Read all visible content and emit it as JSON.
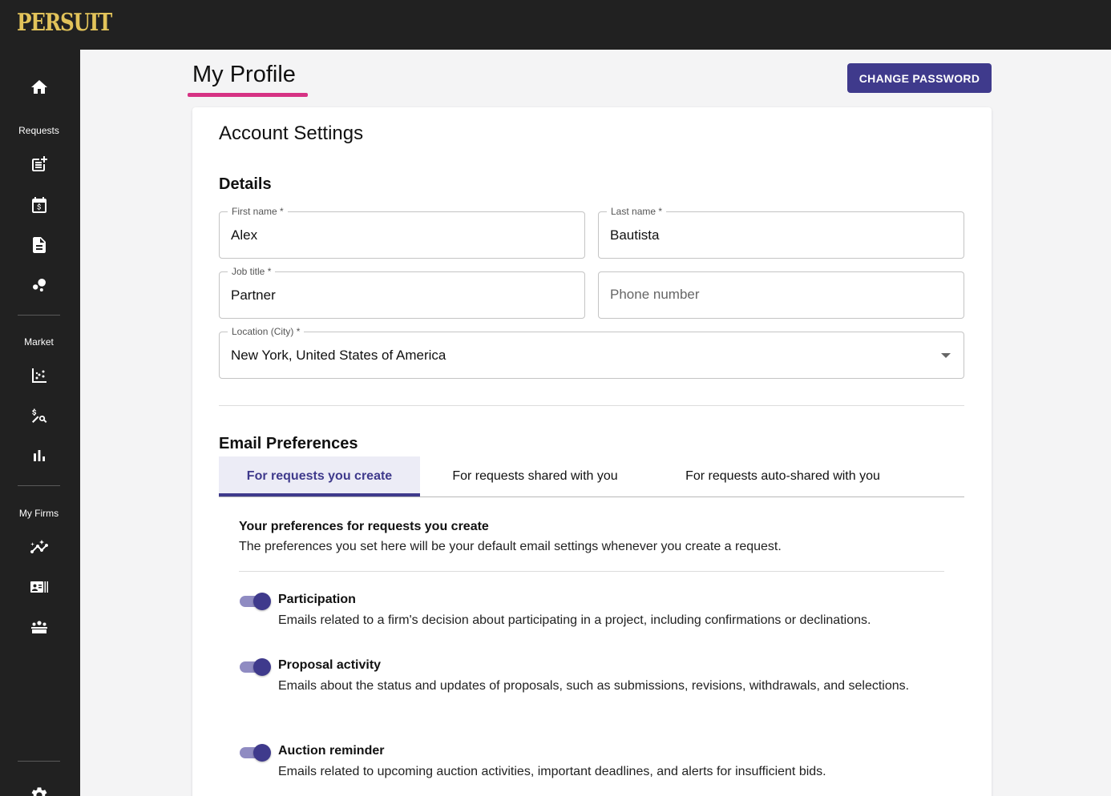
{
  "app": {
    "logo": "PERSUIT"
  },
  "sidebar": {
    "home_icon": "home-icon",
    "sections": [
      {
        "label": "Requests",
        "icons": [
          "post-add-icon",
          "calendar-dollar-icon",
          "document-icon",
          "bubble-chart-icon"
        ]
      },
      {
        "label": "Market",
        "icons": [
          "scatter-plot-icon",
          "price-search-icon",
          "bar-chart-icon"
        ]
      },
      {
        "label": "My Firms",
        "icons": [
          "insights-icon",
          "contact-card-icon",
          "groups-icon"
        ]
      }
    ],
    "bottom_icon": "settings-icon"
  },
  "header": {
    "title": "My Profile",
    "change_password_label": "CHANGE PASSWORD"
  },
  "account": {
    "heading": "Account Settings",
    "details_heading": "Details",
    "first_name": {
      "label": "First name *",
      "value": "Alex"
    },
    "last_name": {
      "label": "Last name *",
      "value": "Bautista"
    },
    "job_title": {
      "label": "Job title *",
      "value": "Partner"
    },
    "phone": {
      "placeholder": "Phone number"
    },
    "location": {
      "label": "Location (City) *",
      "value": "New York, United States of America"
    }
  },
  "email": {
    "heading": "Email Preferences",
    "tabs": [
      {
        "label": "For requests you create",
        "active": true
      },
      {
        "label": "For requests shared with you",
        "active": false
      },
      {
        "label": "For requests auto-shared with you",
        "active": false
      }
    ],
    "pref_title": "Your preferences for requests you create",
    "pref_desc": "The preferences you set here will be your default email settings whenever you create a request.",
    "options": [
      {
        "title": "Participation",
        "desc": "Emails related to a firm's decision about participating in a project, including confirmations or declinations.",
        "enabled": true
      },
      {
        "title": "Proposal activity",
        "desc": "Emails about the status and updates of proposals, such as submissions, revisions, withdrawals, and selections.",
        "enabled": true
      },
      {
        "title": "Auction reminder",
        "desc": "Emails related to upcoming auction activities, important deadlines, and alerts for insufficient bids.",
        "enabled": true
      }
    ]
  },
  "colors": {
    "accent": "#3f3a8c",
    "title_underline": "#d63384",
    "logo": "#e2c35a",
    "sidebar": "#212121"
  }
}
